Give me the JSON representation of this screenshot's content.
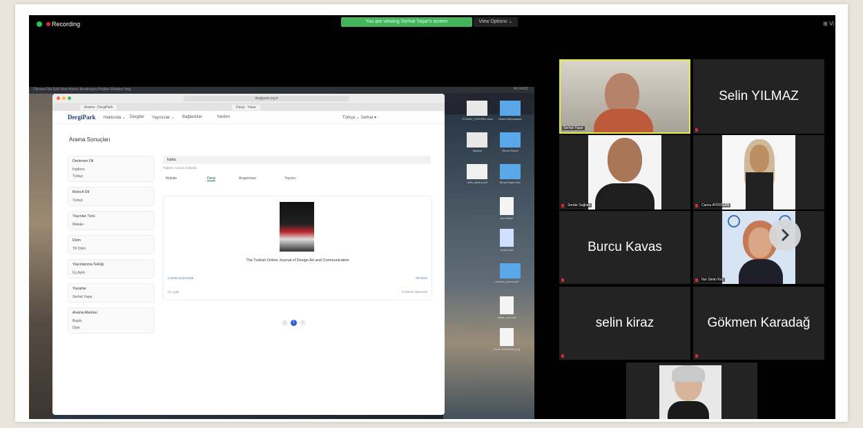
{
  "zoom": {
    "recording_label": "Recording",
    "share_banner": "You are viewing Serhat Yaşar's screen",
    "view_options": "View Options ⌄",
    "top_right": "⊞ Vi"
  },
  "shared_screen": {
    "mac_menu": "  Chrome   File   Edit   View   History   Bookmarks   Profiles   Window   Help",
    "mac_clock": "Fri 14:03",
    "browser": {
      "url": "dergipark.org.tr",
      "tab1": "Arama - DergiPark",
      "tab2": "Dergi - Yasar",
      "logo": "DergiPark",
      "nav": [
        "Hakkında ⌄",
        "Dergiler",
        "Yayıncılar ⌄",
        "Bağlantılar",
        "Yardım"
      ],
      "nav_right": "Türkçe ⌄   Serhat ▾",
      "page_title": "Arama Sonuçları",
      "filters": [
        {
          "title": "Derlenen Dil",
          "options": [
            "İngilizce",
            "Türkçe"
          ]
        },
        {
          "title": "Birincil Dil",
          "options": [
            "Türkçe"
          ]
        },
        {
          "title": "Yayınlar Türü",
          "options": [
            "Makale"
          ]
        },
        {
          "title": "Dizin",
          "options": [
            "TR Dizin"
          ]
        },
        {
          "title": "Yayınlanma Sıklığı",
          "options": [
            "Üç Aylık"
          ]
        },
        {
          "title": "Yazarlar",
          "options": [
            "Serhat Yaşar"
          ]
        },
        {
          "title": "Arama Alanları",
          "options": [
            "Başlık",
            "Özet"
          ]
        }
      ],
      "search_value": "tojdac",
      "result_count": "Toplam 1 sonuç bulundu",
      "result_tabs": [
        "Makale",
        "Dergi",
        "Araştırmacı",
        "Yayıncı"
      ],
      "journal": "The Turkish Online Journal of Design Art and Communication",
      "card_left": "e-ISSN 2146-5193",
      "card_right": "TR Dizin",
      "card_footer_left": "Üç Aylık",
      "card_footer_right": "© ESOS Yayıncılık",
      "page": "1"
    },
    "desktop_icons": [
      "TOJDAC_RAPORU.docx",
      "Video Dökümanları",
      "Toplantı",
      "Ekran Resmi",
      "odev_sablon.pdf",
      "Ekran Kaydı.mov",
      "yeni klasör",
      "sunum.pdf",
      "basvuru_formu.pdf",
      "tojdac_yazi.pdf",
      "Ekran Görüntüsü.png"
    ]
  },
  "gallery": {
    "participants": [
      {
        "id": "serhat",
        "label": "Serhat Yaşar",
        "type": "video"
      },
      {
        "id": "selin-y",
        "name": "Selin YILMAZ",
        "type": "name"
      },
      {
        "id": "serdar",
        "label": "Serdar Sağlam",
        "type": "video"
      },
      {
        "id": "cansu",
        "label": "Cansu AYDOĞAN",
        "type": "video"
      },
      {
        "id": "burcu",
        "name": "Burcu Kavas",
        "type": "name"
      },
      {
        "id": "nur",
        "label": "Nur Simin Koç",
        "type": "video"
      },
      {
        "id": "selin-k",
        "name": "selin kiraz",
        "type": "name"
      },
      {
        "id": "gokmen",
        "name": "Gökmen Karadağ",
        "type": "name"
      },
      {
        "id": "extra",
        "label": "",
        "type": "video"
      }
    ],
    "next_icon": "chevron-right-icon"
  }
}
